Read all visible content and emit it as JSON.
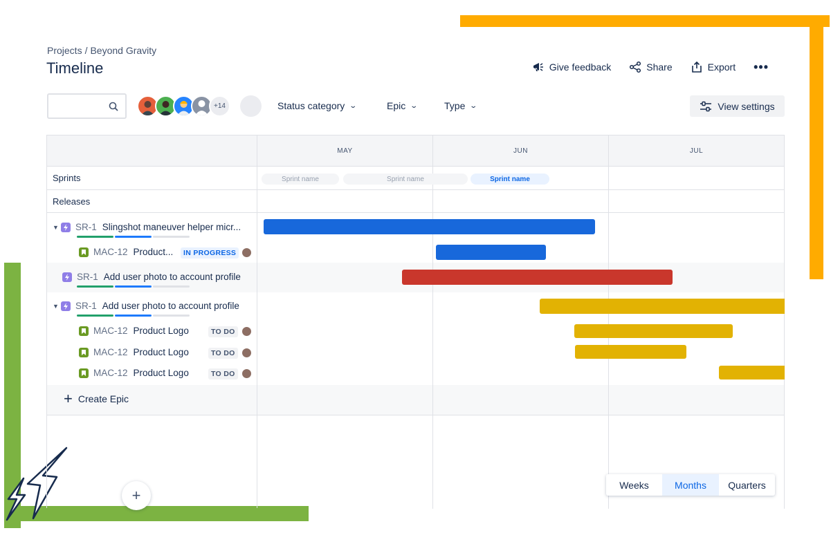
{
  "breadcrumb": {
    "projects": "Projects",
    "separator": "/",
    "project": "Beyond Gravity"
  },
  "page_title": "Timeline",
  "header_actions": {
    "feedback": "Give feedback",
    "share": "Share",
    "export": "Export",
    "more": "•••"
  },
  "toolbar": {
    "avatars_more": "+14",
    "filters": [
      "Status category",
      "Epic",
      "Type"
    ],
    "view_settings": "View settings"
  },
  "months": [
    "MAY",
    "JUN",
    "JUL"
  ],
  "rows": {
    "sprints": "Sprints",
    "releases": "Releases"
  },
  "sprint_names": [
    "Sprint name",
    "Sprint name",
    "Sprint name"
  ],
  "items": [
    {
      "key": "SR-1",
      "title": "Slingshot maneuver helper micr...",
      "type": "epic"
    },
    {
      "key": "MAC-12",
      "title": "Product...",
      "type": "story",
      "status": "IN PROGRESS"
    },
    {
      "key": "SR-1",
      "title": "Add user photo to account profile",
      "type": "epic"
    },
    {
      "key": "SR-1",
      "title": "Add user photo to account profile",
      "type": "epic"
    },
    {
      "key": "MAC-12",
      "title": "Product Logo",
      "type": "story",
      "status": "TO DO"
    },
    {
      "key": "MAC-12",
      "title": "Product Logo",
      "type": "story",
      "status": "TO DO"
    },
    {
      "key": "MAC-12",
      "title": "Product Logo",
      "type": "story",
      "status": "TO DO"
    }
  ],
  "create_epic": "Create Epic",
  "zoom": [
    "Weeks",
    "Months",
    "Quarters"
  ],
  "zoom_selected": "Months",
  "colors": {
    "blue_bar": "#1868db",
    "red_bar": "#c9372c",
    "yellow_bar": "#e2b203",
    "accent_orange": "#ffab00",
    "accent_green": "#7cb342"
  }
}
